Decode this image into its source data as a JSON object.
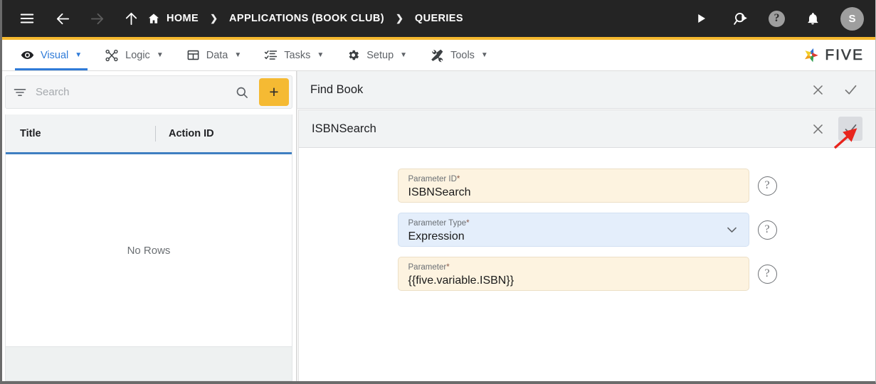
{
  "topbar": {
    "icons": [
      {
        "name": "menu-icon",
        "label": "Menu"
      },
      {
        "name": "back-arrow-icon",
        "label": "Back"
      },
      {
        "name": "forward-arrow-icon",
        "label": "Forward"
      },
      {
        "name": "up-arrow-icon",
        "label": "Up"
      }
    ],
    "breadcrumbs": [
      {
        "label": "HOME",
        "icon": "home-icon"
      },
      {
        "label": "APPLICATIONS (BOOK CLUB)",
        "icon": ""
      },
      {
        "label": "QUERIES",
        "icon": ""
      }
    ],
    "separator": "❯",
    "right_icons": [
      {
        "name": "run-icon",
        "label": "Run"
      },
      {
        "name": "search-run-icon",
        "label": "Search"
      },
      {
        "name": "help-icon",
        "label": "Help",
        "glyph": "?"
      },
      {
        "name": "notifications-bell-icon",
        "label": "Notifications"
      }
    ],
    "avatar_initial": "S",
    "accent_color": "#F5B82E",
    "background_color": "#242424"
  },
  "menubar": {
    "items": [
      {
        "label": "Visual",
        "icon": "eye-icon",
        "caret": "▼",
        "active": true
      },
      {
        "label": "Logic",
        "icon": "logic-nodes-icon",
        "caret": "▼",
        "active": false
      },
      {
        "label": "Data",
        "icon": "table-grid-icon",
        "caret": "▼",
        "active": false
      },
      {
        "label": "Tasks",
        "icon": "checklist-icon",
        "caret": "▼",
        "active": false
      },
      {
        "label": "Setup",
        "icon": "gear-icon",
        "caret": "▼",
        "active": false
      },
      {
        "label": "Tools",
        "icon": "tools-icon",
        "caret": "▼",
        "active": false
      }
    ],
    "active_color": "#2f7bd8",
    "brand": "FIVE"
  },
  "left_panel": {
    "search": {
      "placeholder": "Search",
      "value": "",
      "filter_icon": "filter-icon",
      "search_icon": "search-icon"
    },
    "add_button_label": "+",
    "add_button_color": "#F5BA33",
    "grid": {
      "columns": [
        "Title",
        "Action ID"
      ],
      "rows": [],
      "empty_message": "No Rows",
      "header_underline_color": "#3f7fc1"
    }
  },
  "right_panel": {
    "outer": {
      "title": "Find Book",
      "close_label": "✕",
      "confirm_label": "✓"
    },
    "inner": {
      "title": "ISBNSearch",
      "close_label": "✕",
      "confirm_label": "✓"
    },
    "fields": [
      {
        "label": "Parameter ID",
        "required": "*",
        "value": "ISBNSearch",
        "style": "cream",
        "control": "text",
        "help_glyph": "?"
      },
      {
        "label": "Parameter Type",
        "required": "*",
        "value": "Expression",
        "style": "blue",
        "control": "select",
        "help_glyph": "?"
      },
      {
        "label": "Parameter",
        "required": "*",
        "value": "{{five.variable.ISBN}}",
        "style": "cream",
        "control": "text",
        "help_glyph": "?"
      }
    ]
  },
  "annotation": {
    "arrow_color": "#e8241c",
    "points_to": "inner-confirm-button"
  }
}
